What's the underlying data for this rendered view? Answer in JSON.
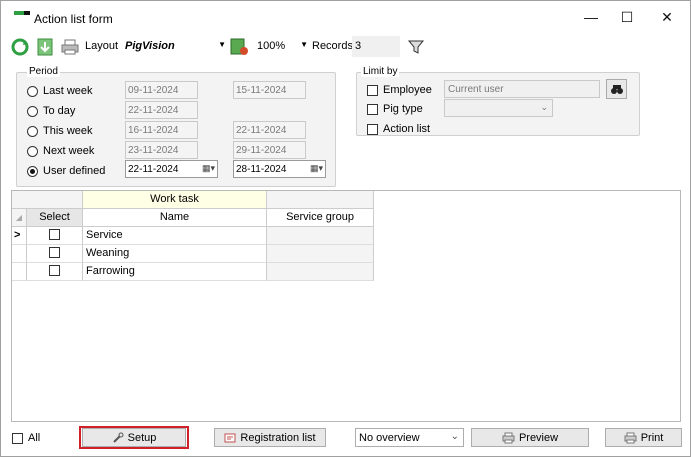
{
  "window": {
    "title": "Action list form",
    "minimize": "—",
    "maximize": "☐",
    "close": "✕"
  },
  "toolbar": {
    "layout_label": "Layout",
    "layout_value": "PigVision",
    "zoom_value": "100%",
    "records_label": "Records",
    "records_value": "3"
  },
  "period": {
    "title": "Period",
    "rows": [
      {
        "label": "Last week",
        "from": "09-11-2024",
        "to": "15-11-2024",
        "selected": false
      },
      {
        "label": "To day",
        "from": "22-11-2024",
        "to": "",
        "selected": false
      },
      {
        "label": "This week",
        "from": "16-11-2024",
        "to": "22-11-2024",
        "selected": false
      },
      {
        "label": "Next week",
        "from": "23-11-2024",
        "to": "29-11-2024",
        "selected": false
      },
      {
        "label": "User defined",
        "from": "22-11-2024",
        "to": "28-11-2024",
        "selected": true
      }
    ]
  },
  "limit_by": {
    "title": "Limit by",
    "employee_label": "Employee",
    "employee_value": "Current user",
    "pig_type_label": "Pig type",
    "pig_type_value": "",
    "action_list_label": "Action list"
  },
  "grid": {
    "band_label": "Work task",
    "columns": [
      "Select",
      "Name",
      "Service group"
    ],
    "rows": [
      {
        "name": "Service",
        "service_group": ""
      },
      {
        "name": "Weaning",
        "service_group": ""
      },
      {
        "name": "Farrowing",
        "service_group": ""
      }
    ],
    "current_row_marker": ">"
  },
  "bottom": {
    "all_label": "All",
    "setup_label": "Setup",
    "registration_label": "Registration list",
    "overview_value": "No overview",
    "preview_label": "Preview",
    "print_label": "Print"
  },
  "colors": {
    "highlight": "#d0202a",
    "band": "#ffffe6",
    "accent_green": "#2ea043"
  }
}
